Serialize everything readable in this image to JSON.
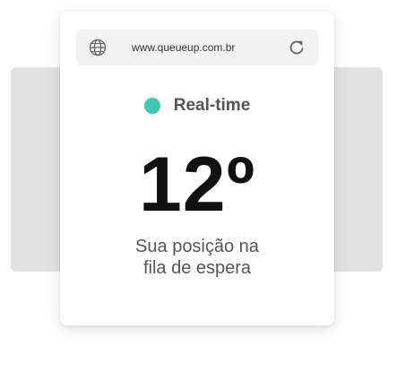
{
  "browser": {
    "url": "www.queueup.com.br",
    "left_icon": "globe-icon",
    "right_icon": "reload-icon"
  },
  "status": {
    "label": "Real-time",
    "indicator_color": "#3cc9b0"
  },
  "queue": {
    "position": "12º",
    "caption_line1": "Sua posição na",
    "caption_line2": "fila de espera"
  }
}
